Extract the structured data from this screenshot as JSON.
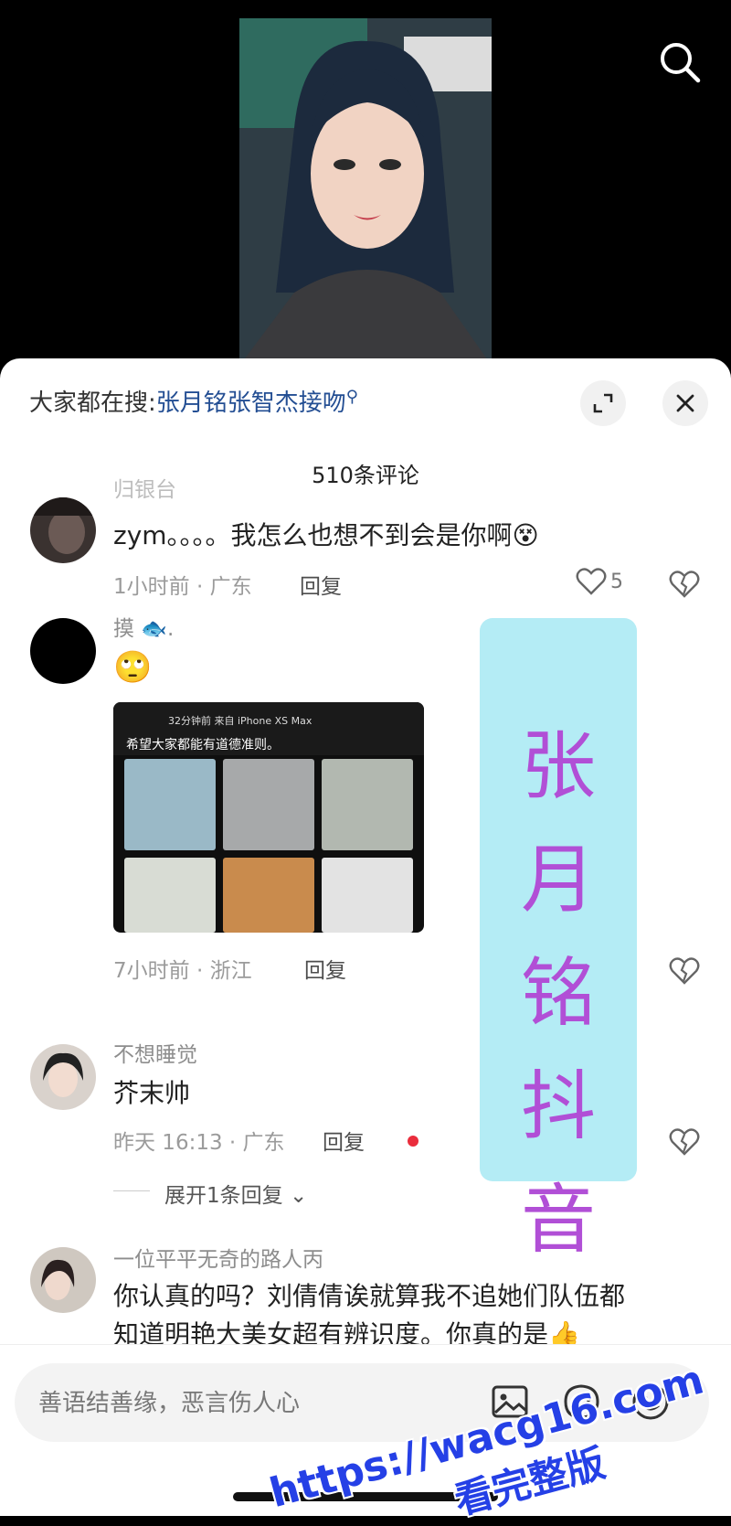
{
  "header": {
    "search_icon": "search-icon"
  },
  "sheet": {
    "hot_prefix": "大家都在搜:",
    "hot_keyword": "张月铭张智杰接吻",
    "comment_count": "510条评论"
  },
  "comments": [
    {
      "user": "归银台",
      "text": "zym。。。。我怎么也想不到会是你啊",
      "emoji": "😵",
      "time": "1小时前 · 广东",
      "reply": "回复",
      "likes": "5"
    },
    {
      "user": "摸",
      "user_emoji": "🐟",
      "user_suffix": ".",
      "text": "🙄",
      "time": "7小时前 · 浙江",
      "reply": "回复",
      "image": {
        "top_time": "32分钟前  来自 iPhone XS Max",
        "caption": "希望大家都能有道德准则。"
      }
    },
    {
      "user": "不想睡觉",
      "text": "芥末帅",
      "time": "昨天 16:13 · 广东",
      "reply": "回复",
      "expand": "展开1条回复"
    },
    {
      "user": "一位平平无奇的路人丙",
      "text": "你认真的吗？刘倩倩诶就算我不追她们队伍都",
      "text2": "知道明艳大美女超有辨识度。你真的是",
      "emoji2": "👍"
    }
  ],
  "banner": {
    "lines": [
      "张",
      "月",
      "铭",
      "抖",
      "音"
    ]
  },
  "input": {
    "placeholder": "善语结善缘，恶言伤人心"
  },
  "watermark": {
    "url": "https://wacg16.com",
    "text": "看完整版"
  },
  "colors": {
    "keyword": "#234e93",
    "banner_bg": "#b4ecf5",
    "banner_text": "#b14fd6",
    "watermark": "#2540e6"
  }
}
